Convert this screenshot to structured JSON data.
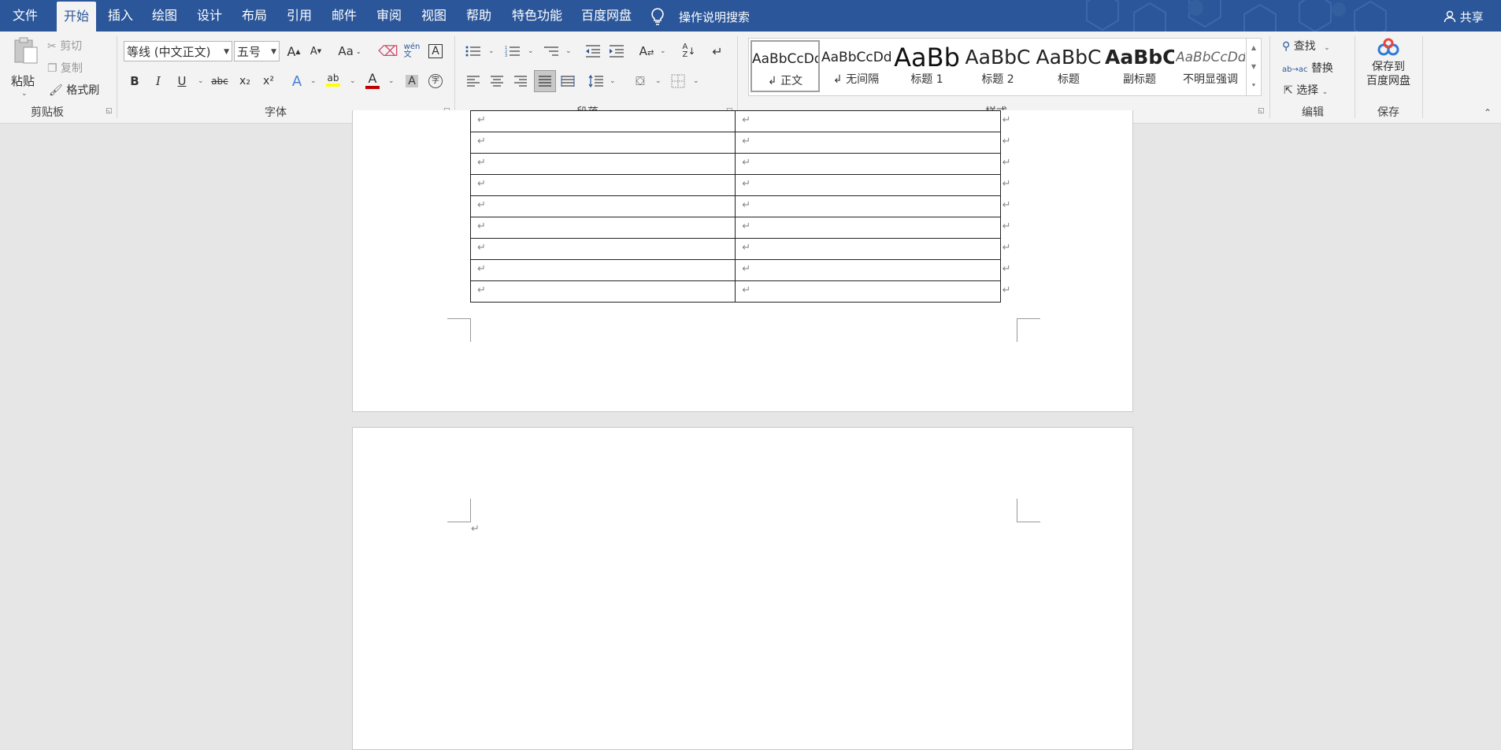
{
  "menu": {
    "tabs": [
      "文件",
      "开始",
      "插入",
      "绘图",
      "设计",
      "布局",
      "引用",
      "邮件",
      "审阅",
      "视图",
      "帮助",
      "特色功能",
      "百度网盘"
    ],
    "active_index": 1,
    "search_label": "操作说明搜索",
    "share_label": "共享"
  },
  "clipboard": {
    "paste_label": "粘贴",
    "cut_label": "剪切",
    "copy_label": "复制",
    "format_painter_label": "格式刷",
    "group_label": "剪贴板"
  },
  "font": {
    "name": "等线 (中文正文)",
    "size": "五号",
    "group_label": "字体",
    "grow_glyph": "A",
    "shrink_glyph": "A",
    "case_glyph": "Aa",
    "bold_glyph": "B",
    "italic_glyph": "I",
    "underline_glyph": "U",
    "strike_glyph": "abc",
    "sub_glyph": "x₂",
    "sup_glyph": "x²",
    "effects_glyph": "A",
    "highlight_glyph": "ab",
    "color_glyph": "A",
    "shading_glyph": "A",
    "enclose_glyph": "字"
  },
  "paragraph": {
    "group_label": "段落"
  },
  "styles": {
    "group_label": "样式",
    "items": [
      {
        "preview": "AaBbCcDd",
        "name": "↲ 正文"
      },
      {
        "preview": "AaBbCcDd",
        "name": "↲ 无间隔"
      },
      {
        "preview": "AaBb",
        "name": "标题 1"
      },
      {
        "preview": "AaBbC",
        "name": "标题 2"
      },
      {
        "preview": "AaBbC",
        "name": "标题"
      },
      {
        "preview": "AaBbC",
        "name": "副标题"
      },
      {
        "preview": "AaBbCcDd",
        "name": "不明显强调"
      }
    ]
  },
  "editing": {
    "find_label": "查找",
    "replace_label": "替换",
    "select_label": "选择",
    "group_label": "编辑"
  },
  "save": {
    "button_label_line1": "保存到",
    "button_label_line2": "百度网盘",
    "group_label": "保存"
  },
  "document": {
    "paragraph_mark": "↵",
    "table_rows": 9
  },
  "colors": {
    "accent": "#2b579a",
    "ribbon": "#f3f3f3",
    "canvas": "#e6e6e6",
    "font_color_bar": "#c00000",
    "highlight_bar": "#ffff00"
  },
  "icons": {
    "search": "lightbulb-icon",
    "share": "person-icon",
    "save": "cloud-icon"
  }
}
